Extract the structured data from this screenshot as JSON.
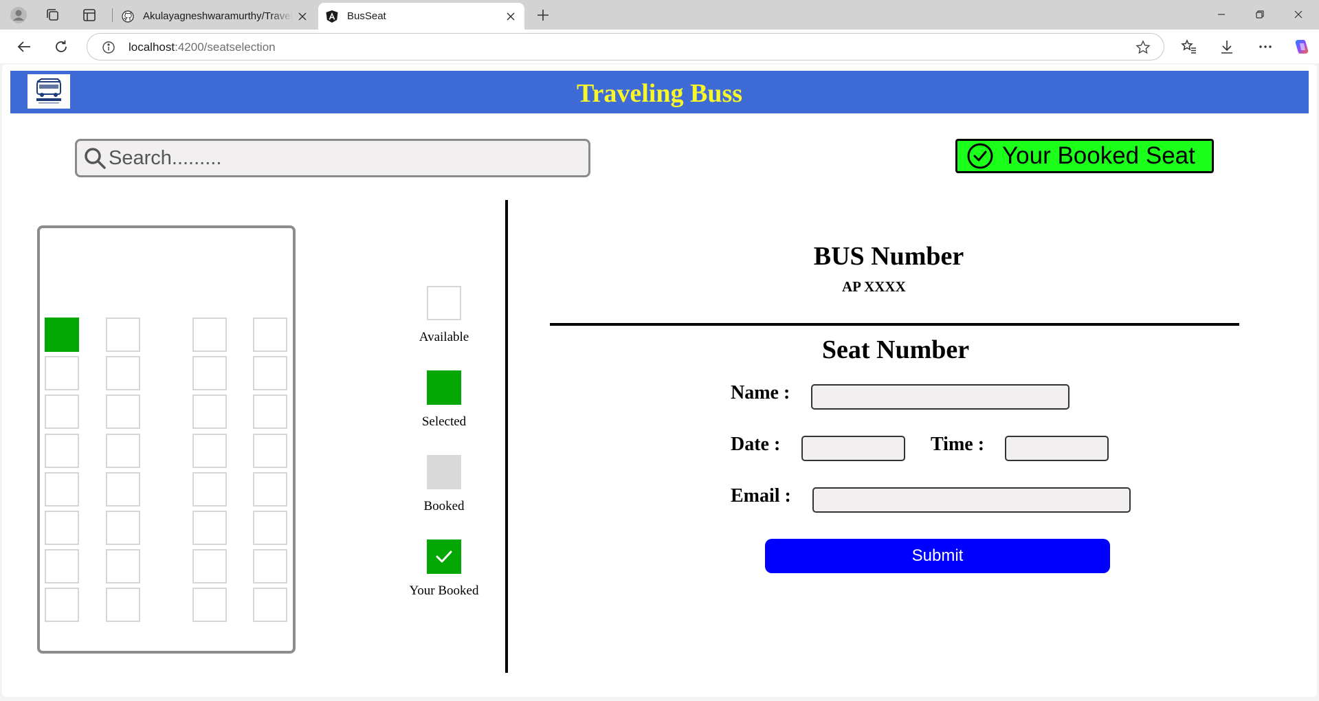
{
  "browser": {
    "tabs": [
      {
        "title": "Akulayagneshwaramurthy/Traveling-Bus",
        "favicon": "github-icon",
        "active": false
      },
      {
        "title": "BusSeat",
        "favicon": "angular-icon",
        "active": true
      }
    ],
    "url_host": "localhost",
    "url_path": ":4200/seatselection"
  },
  "header": {
    "title": "Traveling Buss",
    "background_color": "#3f6bd6",
    "title_color": "#f7f72a",
    "logo": "travel-bus-logo"
  },
  "search": {
    "placeholder": "Search........."
  },
  "booked_seat_button": {
    "label": "Your Booked Seat",
    "color": "#1bff1b"
  },
  "seat_map": {
    "rows": 8,
    "columns": 4,
    "selected_seats": [
      [
        0,
        0
      ]
    ]
  },
  "legend": [
    {
      "label": "Available",
      "state": "available"
    },
    {
      "label": "Selected",
      "state": "selected",
      "color": "#04a804"
    },
    {
      "label": "Booked",
      "state": "booked",
      "color": "#d9d9d9"
    },
    {
      "label": "Your Booked",
      "state": "your-booked",
      "color": "#04a804"
    }
  ],
  "bus_info": {
    "heading": "BUS Number",
    "number": "AP XXXX",
    "seat_heading": "Seat Number"
  },
  "form": {
    "name_label": "Name :",
    "name_value": "",
    "date_label": "Date :",
    "date_value": "",
    "time_label": "Time :",
    "time_value": "",
    "email_label": "Email :",
    "email_value": "",
    "submit_label": "Submit",
    "submit_color": "#0000ff"
  }
}
